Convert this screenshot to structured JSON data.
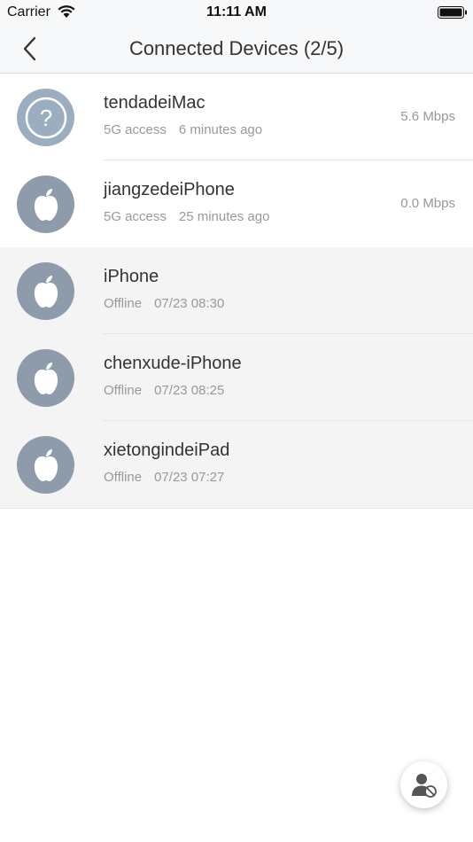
{
  "status_bar": {
    "carrier": "Carrier",
    "time": "11:11 AM"
  },
  "nav": {
    "title": "Connected Devices (2/5)"
  },
  "devices": [
    {
      "name": "tendadeiMac",
      "connection": "5G access",
      "time": "6 minutes ago",
      "speed": "5.6 Mbps",
      "icon": "question-icon",
      "status": "online"
    },
    {
      "name": "jiangzedeiPhone",
      "connection": "5G access",
      "time": "25 minutes ago",
      "speed": "0.0 Mbps",
      "icon": "apple-icon",
      "status": "online"
    },
    {
      "name": "iPhone",
      "connection": "Offline",
      "time": "07/23 08:30",
      "icon": "apple-icon",
      "status": "offline"
    },
    {
      "name": "chenxude-iPhone",
      "connection": "Offline",
      "time": "07/23 08:25",
      "icon": "apple-icon",
      "status": "offline"
    },
    {
      "name": "xietongindeiPad",
      "connection": "Offline",
      "time": "07/23 07:27",
      "icon": "apple-icon",
      "status": "offline"
    }
  ],
  "fab": {
    "icon": "user-block-icon"
  },
  "colors": {
    "avatar": "#8e9bab",
    "avatar_unknown": "#9aaec0",
    "offline_bg": "#f4f4f4",
    "secondary_text": "#999999"
  }
}
